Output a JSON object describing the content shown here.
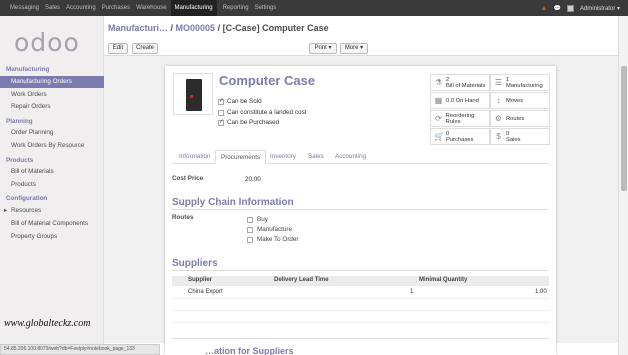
{
  "topnav": {
    "items": [
      "Messaging",
      "Sales",
      "Accounting",
      "Purchases",
      "Warehouse",
      "Manufacturing",
      "Reporting",
      "Settings"
    ],
    "active": "Manufacturing",
    "user": "Administrator ▾"
  },
  "logo": "odoo",
  "sidebar": {
    "sections": [
      {
        "title": "Manufacturing",
        "items": [
          "Manufacturing Orders",
          "Work Orders",
          "Repair Orders"
        ]
      },
      {
        "title": "Planning",
        "items": [
          "Order Planning",
          "Work Orders By Resource"
        ]
      },
      {
        "title": "Products",
        "items": [
          "Bill of Materials",
          "Products"
        ]
      },
      {
        "title": "Configuration",
        "items": [
          "Resources",
          "Bill of Material Components",
          "Property Groups"
        ]
      }
    ],
    "active_item": "Manufacturing Orders"
  },
  "breadcrumb": {
    "part1": "Manufacturi…",
    "sep1": " / ",
    "part2": "MO00005",
    "sep2": " / ",
    "current": "[C-Case] Computer Case"
  },
  "buttons": {
    "edit": "Edit",
    "create": "Create",
    "print": "Print ▾",
    "more": "More ▾"
  },
  "product": {
    "name": "Computer Case",
    "checkboxes": [
      {
        "label": "Can be Sold",
        "checked": true
      },
      {
        "label": "Can constitute a landed cost",
        "checked": false
      },
      {
        "label": "Can be Purchased",
        "checked": true
      }
    ]
  },
  "smart_buttons": [
    {
      "icon": "flask-icon",
      "line1": "2",
      "line2": "Bill of Materials"
    },
    {
      "icon": "list-icon",
      "line1": "1",
      "line2": "Manufacturing"
    },
    {
      "icon": "building-icon",
      "line1": "0.0 On Hand",
      "line2": ""
    },
    {
      "icon": "arrows-v-icon",
      "line1": "Moves",
      "line2": ""
    },
    {
      "icon": "refresh-icon",
      "line1": "Reordering Rules",
      "line2": ""
    },
    {
      "icon": "cogs-icon",
      "line1": "Routes",
      "line2": ""
    },
    {
      "icon": "cart-icon",
      "line1": "0",
      "line2": "Purchases"
    },
    {
      "icon": "dollar-icon",
      "line1": "0",
      "line2": "Sales"
    }
  ],
  "tabs": [
    "Information",
    "Procurements",
    "Inventory",
    "Sales",
    "Accounting"
  ],
  "active_tab": "Procurements",
  "cost_price": {
    "label": "Cost Price",
    "value": "20.00"
  },
  "supply_chain": {
    "title": "Supply Chain Information",
    "routes_label": "Routes",
    "routes": [
      {
        "label": "Buy",
        "checked": false
      },
      {
        "label": "Manufacture",
        "checked": false
      },
      {
        "label": "Make To Order",
        "checked": false
      }
    ]
  },
  "suppliers": {
    "title": "Suppliers",
    "columns": [
      "Supplier",
      "Delivery Lead Time",
      "Minimal Quantity"
    ],
    "rows": [
      {
        "supplier": "China Export",
        "lead_time": "1",
        "min_qty": "1.00"
      }
    ]
  },
  "next_section_peek": "…ation for Suppliers",
  "watermark": "www.globalteckz.com",
  "status_url": "54.85.206.100:8079/web?db=Feelply#notebook_page_133"
}
